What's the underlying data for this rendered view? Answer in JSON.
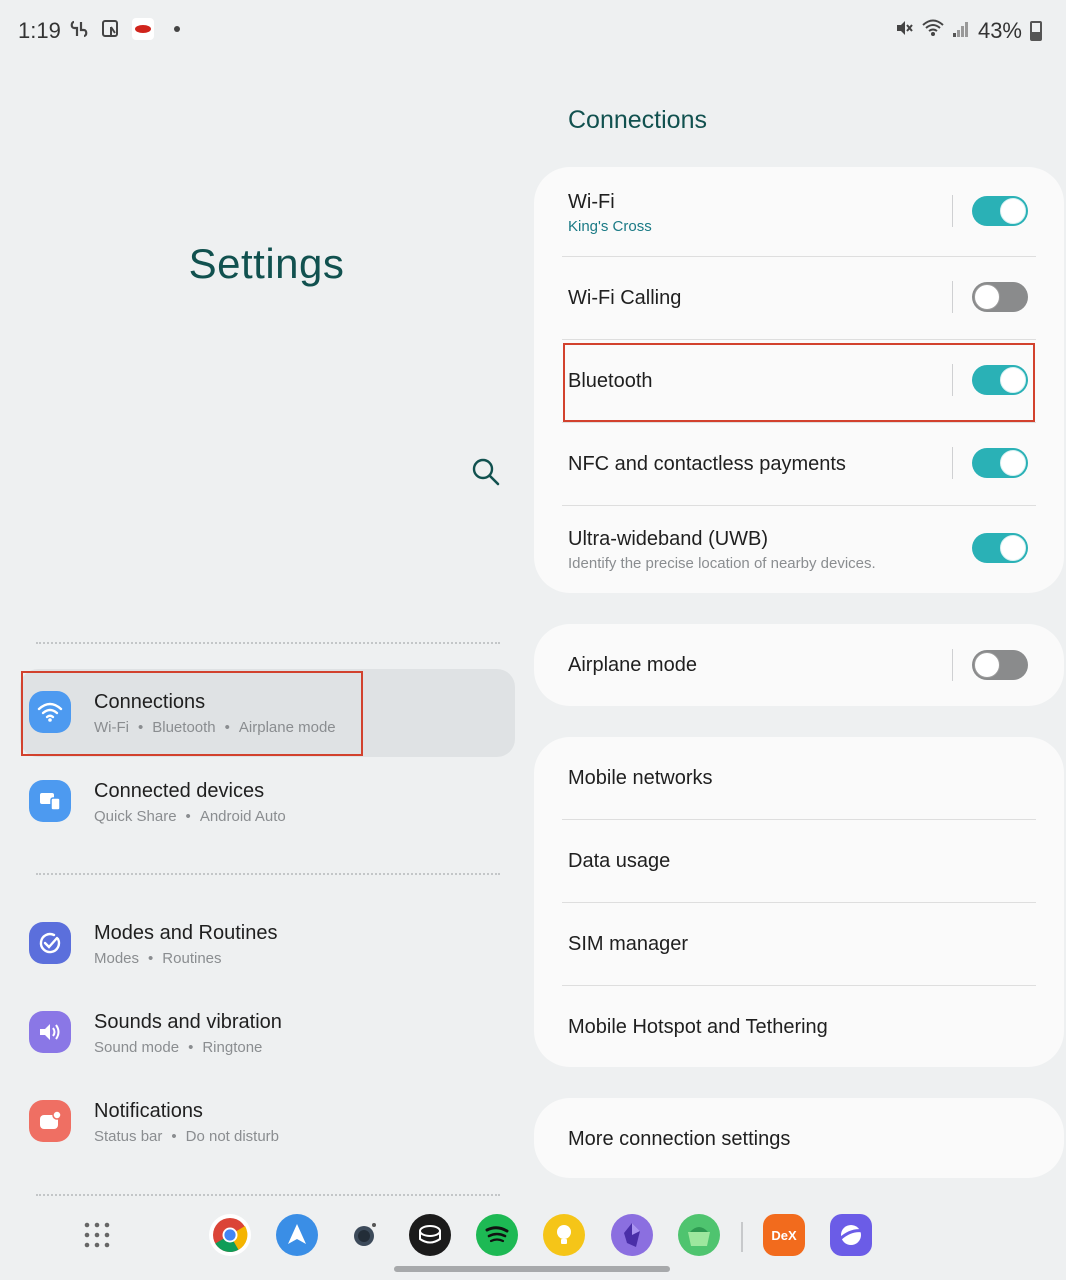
{
  "status_bar": {
    "time": "1:19",
    "battery": "43%",
    "left_icons": [
      "s-icon",
      "screen-touch-icon",
      "red-app-icon",
      "notification-dot-icon"
    ],
    "right_icons": [
      "mute-icon",
      "wifi-icon",
      "signal-icon",
      "battery-icon"
    ]
  },
  "left_pane": {
    "title": "Settings",
    "search_icon": "search-icon",
    "menu": [
      {
        "title": "Connections",
        "subtitle_parts": [
          "Wi-Fi",
          "Bluetooth",
          "Airplane mode"
        ],
        "icon": "wifi-icon",
        "icon_color": "#4d9af0",
        "active": true
      },
      {
        "title": "Connected devices",
        "subtitle_parts": [
          "Quick Share",
          "Android Auto"
        ],
        "icon": "devices-icon",
        "icon_color": "#4d9af0"
      },
      {
        "title": "Modes and Routines",
        "subtitle_parts": [
          "Modes",
          "Routines"
        ],
        "icon": "check-circle-icon",
        "icon_color": "#5b6fdc"
      },
      {
        "title": "Sounds and vibration",
        "subtitle_parts": [
          "Sound mode",
          "Ringtone"
        ],
        "icon": "volume-icon",
        "icon_color": "#8a77e6"
      },
      {
        "title": "Notifications",
        "subtitle_parts": [
          "Status bar",
          "Do not disturb"
        ],
        "icon": "bell-icon",
        "icon_color": "#ef6f63"
      }
    ]
  },
  "right_pane": {
    "section_title": "Connections",
    "group1": [
      {
        "title": "Wi-Fi",
        "subtitle": "King's Cross",
        "toggle": true
      },
      {
        "title": "Wi-Fi Calling",
        "toggle": false
      },
      {
        "title": "Bluetooth",
        "toggle": true
      },
      {
        "title": "NFC and contactless payments",
        "toggle": true
      },
      {
        "title": "Ultra-wideband (UWB)",
        "subtitle": "Identify the precise location of nearby devices.",
        "toggle": true
      }
    ],
    "group2": [
      {
        "title": "Airplane mode",
        "toggle": false
      }
    ],
    "group3": [
      {
        "title": "Mobile networks"
      },
      {
        "title": "Data usage"
      },
      {
        "title": "SIM manager"
      },
      {
        "title": "Mobile Hotspot and Tethering"
      }
    ],
    "group4": [
      {
        "title": "More connection settings"
      }
    ]
  },
  "dock": {
    "apps": [
      "apps-grid-icon",
      "chrome-icon",
      "spark-mail-icon",
      "camera-app-icon",
      "spatial-icon",
      "spotify-icon",
      "lightbulb-app-icon",
      "obsidian-icon",
      "green-app-icon",
      "dex-icon",
      "samsung-internet-icon"
    ],
    "dex_label": "DeX",
    "colors": {
      "chrome": "#ffffff",
      "spotify": "#1db954",
      "dex": "#f26b1d",
      "internet": "#6b5ce7",
      "obsidian": "#7c5ad6",
      "keep": "#f5c518"
    }
  },
  "accent_teal": "#2ab1b6",
  "highlight_color": "#d2412d"
}
